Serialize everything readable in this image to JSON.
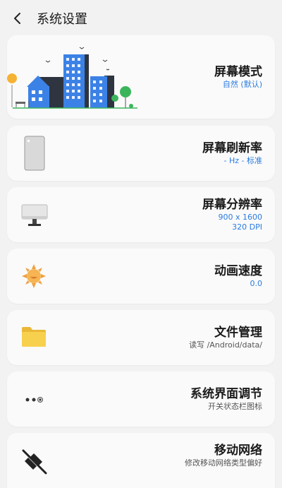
{
  "header": {
    "title": "系统设置"
  },
  "items": [
    {
      "title": "屏幕模式",
      "subtitle": "自然 (默认)"
    },
    {
      "title": "屏幕刷新率",
      "subtitle": "- Hz - 标准"
    },
    {
      "title": "屏幕分辨率",
      "subtitle_lines": [
        "900 x 1600",
        "320 DPI"
      ]
    },
    {
      "title": "动画速度",
      "subtitle": "0.0"
    },
    {
      "title": "文件管理",
      "subtitle": "读写 /Android/data/"
    },
    {
      "title": "系统界面调节",
      "subtitle": "开关状态栏图标"
    },
    {
      "title": "移动网络",
      "subtitle": "修改移动网络类型偏好"
    }
  ],
  "colors": {
    "accent": "#2a7be0",
    "background": "#f2f2f2",
    "card": "#fafafa"
  },
  "icons": [
    "back-arrow-icon",
    "city-illustration-icon",
    "phone-icon",
    "monitor-icon",
    "sun-icon",
    "folder-icon",
    "dots-icon",
    "no-signal-icon"
  ]
}
